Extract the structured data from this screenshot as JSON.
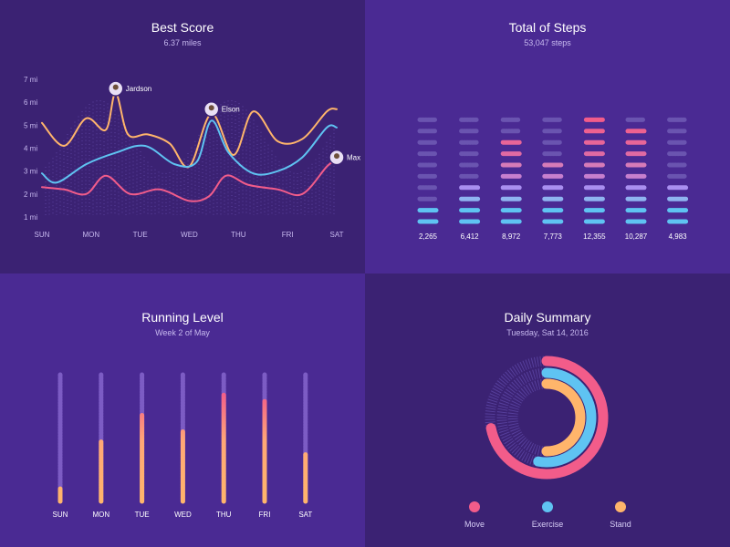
{
  "panels": {
    "best_score": {
      "title": "Best Score",
      "subtitle": "6.37 miles"
    },
    "steps": {
      "title": "Total of Steps",
      "subtitle": "53,047 steps"
    },
    "running": {
      "title": "Running Level",
      "subtitle": "Week 2 of May"
    },
    "daily": {
      "title": "Daily Summary",
      "subtitle": "Tuesday, Sat 14, 2016"
    }
  },
  "colors": {
    "orange": "#ffb56b",
    "blue": "#5fc3f2",
    "pink": "#f25c8a",
    "violet": "#a98ff0",
    "track": "#7c5cc4"
  },
  "chart_data": [
    {
      "type": "line",
      "title": "Best Score",
      "subtitle": "6.37 miles",
      "categories": [
        "SUN",
        "MON",
        "TUE",
        "WED",
        "THU",
        "FRI",
        "SAT"
      ],
      "y_ticks": [
        "1 mi",
        "2 mi",
        "3 mi",
        "4 mi",
        "5 mi",
        "6 mi",
        "7 mi"
      ],
      "ylim": [
        1,
        7
      ],
      "annotations": [
        {
          "label": "Jardson",
          "x": 1.5,
          "y": 6.6,
          "series": "Orange"
        },
        {
          "label": "Elson",
          "x": 3.45,
          "y": 5.7,
          "series": "Orange"
        },
        {
          "label": "Max",
          "x": 6.0,
          "y": 3.6,
          "series": "Pink"
        }
      ],
      "series": [
        {
          "color": "#ffb56b",
          "x": [
            0,
            0.45,
            0.9,
            1.3,
            1.5,
            1.75,
            2.15,
            2.6,
            3.0,
            3.45,
            3.9,
            4.3,
            4.8,
            5.3,
            5.8,
            6.0
          ],
          "y": [
            5.1,
            4.1,
            5.3,
            4.8,
            6.4,
            4.6,
            4.6,
            4.2,
            3.2,
            5.5,
            3.7,
            5.6,
            4.3,
            4.4,
            5.6,
            5.7
          ]
        },
        {
          "color": "#5fc3f2",
          "x": [
            0,
            0.3,
            0.9,
            1.5,
            2.1,
            2.7,
            3.15,
            3.45,
            3.8,
            4.3,
            4.8,
            5.3,
            5.8,
            6.0
          ],
          "y": [
            2.9,
            2.5,
            3.3,
            3.8,
            4.1,
            3.3,
            3.4,
            5.2,
            3.8,
            2.9,
            3.0,
            3.6,
            4.9,
            4.9
          ]
        },
        {
          "color": "#f25c8a",
          "x": [
            0,
            0.45,
            0.9,
            1.3,
            1.8,
            2.4,
            3.0,
            3.4,
            3.75,
            4.2,
            4.8,
            5.3,
            5.8,
            6.0
          ],
          "y": [
            2.3,
            2.2,
            2.0,
            2.8,
            2.0,
            2.2,
            1.7,
            1.9,
            2.8,
            2.4,
            2.2,
            2.0,
            3.2,
            3.5
          ]
        }
      ]
    },
    {
      "type": "bar",
      "title": "Total of Steps",
      "subtitle": "53,047 steps",
      "categories": [
        "SUN",
        "MON",
        "TUE",
        "WED",
        "THU",
        "FRI",
        "SAT"
      ],
      "value_labels": [
        "2,265",
        "6,412",
        "8,972",
        "7,773",
        "12,355",
        "10,287",
        "4,983"
      ],
      "values": [
        2265,
        6412,
        8972,
        7773,
        12355,
        10287,
        4983
      ],
      "levels": 10,
      "filled_levels": [
        2,
        4,
        8,
        6,
        10,
        9,
        4
      ]
    },
    {
      "type": "bar",
      "title": "Running Level",
      "subtitle": "Week 2 of May",
      "categories": [
        "SUN",
        "MON",
        "TUE",
        "WED",
        "THU",
        "FRI",
        "SAT"
      ],
      "values": [
        0.1,
        0.47,
        0.68,
        0.55,
        0.84,
        0.79,
        0.37
      ],
      "ylim": [
        0,
        1
      ]
    },
    {
      "type": "pie",
      "title": "Daily Summary",
      "subtitle": "Tuesday, Sat 14, 2016",
      "series": [
        {
          "name": "Move",
          "value": 0.72,
          "color": "#f25c8a"
        },
        {
          "name": "Exercise",
          "value": 0.53,
          "color": "#5fc3f2"
        },
        {
          "name": "Stand",
          "value": 0.5,
          "color": "#ffb56b"
        }
      ]
    }
  ]
}
